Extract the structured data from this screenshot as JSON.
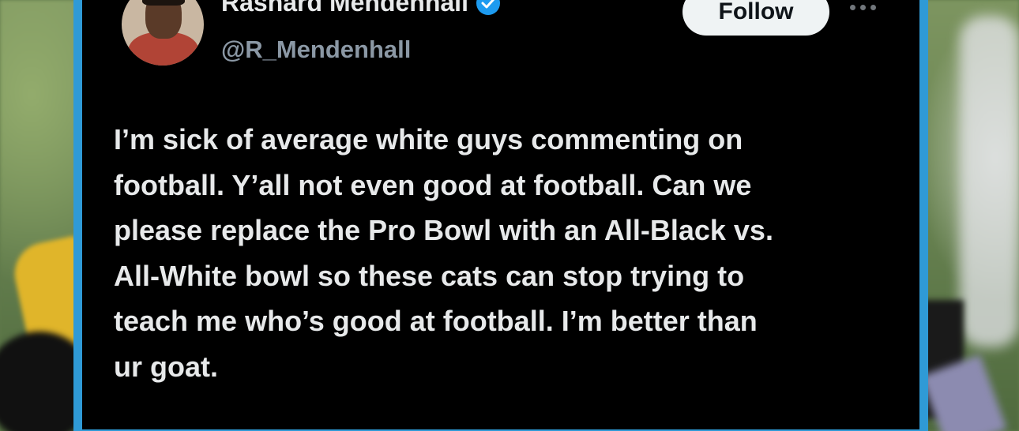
{
  "tweet": {
    "author": {
      "display_name": "Rashard Mendenhall",
      "handle": "@R_Mendenhall",
      "verified": true,
      "avatar_icon": "profile-photo"
    },
    "follow_label": "Follow",
    "more_label": "···",
    "text_lines": [
      "I’m sick of average white guys commenting on",
      "football. Y’all not even good at football. Can we",
      "please replace the Pro Bowl with an All-Black vs.",
      "All-White bowl so these cats can stop trying to",
      "teach me who’s good at football. I’m better than",
      "ur goat."
    ]
  },
  "colors": {
    "card_border": "#2f9ad6",
    "card_background": "#000000",
    "text_primary": "#e7e9ea",
    "text_secondary": "#8b98a5",
    "verified_badge": "#1d9bf0",
    "follow_button_bg": "#eff3f4"
  }
}
